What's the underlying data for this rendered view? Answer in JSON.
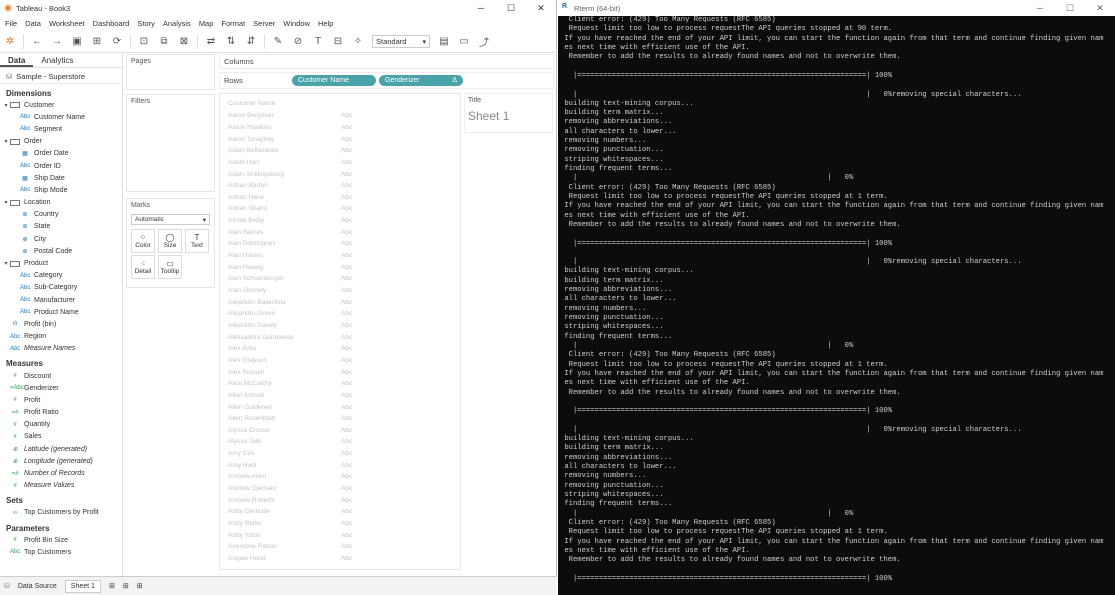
{
  "tableau": {
    "title": "Tableau - Book3",
    "menu": [
      "File",
      "Data",
      "Worksheet",
      "Dashboard",
      "Story",
      "Analysis",
      "Map",
      "Format",
      "Server",
      "Window",
      "Help"
    ],
    "standard_label": "Standard",
    "tabs": {
      "data": "Data",
      "analytics": "Analytics"
    },
    "source": "Sample - Superstore",
    "dimensions_label": "Dimensions",
    "dimensions": [
      {
        "type": "folder",
        "label": "Customer"
      },
      {
        "type": "field",
        "icon": "Abc",
        "label": "Customer Name"
      },
      {
        "type": "field",
        "icon": "Abc",
        "label": "Segment"
      },
      {
        "type": "folder",
        "label": "Order"
      },
      {
        "type": "field",
        "icon": "▦",
        "label": "Order Date"
      },
      {
        "type": "field",
        "icon": "Abc",
        "label": "Order ID"
      },
      {
        "type": "field",
        "icon": "▦",
        "label": "Ship Date"
      },
      {
        "type": "field",
        "icon": "Abc",
        "label": "Ship Mode"
      },
      {
        "type": "folder",
        "label": "Location"
      },
      {
        "type": "field",
        "icon": "⊕",
        "label": "Country"
      },
      {
        "type": "field",
        "icon": "⊕",
        "label": "State"
      },
      {
        "type": "field",
        "icon": "⊕",
        "label": "City"
      },
      {
        "type": "field",
        "icon": "⊕",
        "label": "Postal Code"
      },
      {
        "type": "folder",
        "label": "Product"
      },
      {
        "type": "field",
        "icon": "Abc",
        "label": "Category"
      },
      {
        "type": "field",
        "icon": "Abc",
        "label": "Sub-Category"
      },
      {
        "type": "field",
        "icon": "Abc",
        "label": "Manufacturer"
      },
      {
        "type": "field",
        "icon": "Abc",
        "label": "Product Name"
      },
      {
        "type": "top",
        "icon": "ılı",
        "label": "Profit (bin)"
      },
      {
        "type": "top",
        "icon": "Abc",
        "label": "Region"
      },
      {
        "type": "top",
        "icon": "Abc",
        "label": "Measure Names",
        "italic": true
      }
    ],
    "measures_label": "Measures",
    "measures": [
      {
        "icon": "#",
        "label": "Discount"
      },
      {
        "icon": "=Abc",
        "label": "Genderizer"
      },
      {
        "icon": "#",
        "label": "Profit"
      },
      {
        "icon": "=#",
        "label": "Profit Ratio"
      },
      {
        "icon": "#",
        "label": "Quantity"
      },
      {
        "icon": "#",
        "label": "Sales"
      },
      {
        "icon": "⊕",
        "label": "Latitude (generated)",
        "italic": true
      },
      {
        "icon": "⊕",
        "label": "Longitude (generated)",
        "italic": true
      },
      {
        "icon": "=#",
        "label": "Number of Records",
        "italic": true
      },
      {
        "icon": "#",
        "label": "Measure Values",
        "italic": true
      }
    ],
    "sets_label": "Sets",
    "sets": [
      {
        "icon": "∞",
        "label": "Top Customers by Profit"
      }
    ],
    "parameters_label": "Parameters",
    "parameters": [
      {
        "icon": "#",
        "label": "Profit Bin Size"
      },
      {
        "icon": "Abc",
        "label": "Top Customers"
      }
    ],
    "pages_label": "Pages",
    "filters_label": "Filters",
    "marks_label": "Marks",
    "marks_type": "Automatic",
    "mark_buttons": [
      {
        "glyph": "⁘",
        "label": "Color"
      },
      {
        "glyph": "◯",
        "label": "Size"
      },
      {
        "glyph": "T",
        "label": "Text"
      },
      {
        "glyph": "⁖",
        "label": "Detail"
      },
      {
        "glyph": "▭",
        "label": "Tooltip"
      }
    ],
    "columns_label": "Columns",
    "rows_label": "Rows",
    "row_pills": [
      "Customer Name",
      "Genderizer"
    ],
    "row_pill_delta": "Δ",
    "viz_header": "Customer Name",
    "viz_rows": [
      "Aaron Bergman",
      "Aaron Hawkins",
      "Aaron Smayling",
      "Adam Bellavance",
      "Adam Hart",
      "Adam Shillingsburg",
      "Adrian Barton",
      "Adrian Hane",
      "Adrian Shami",
      "Aimee Bixby",
      "Alan Barnes",
      "Alan Dominguez",
      "Alan Haines",
      "Alan Hwang",
      "Alan Schoenberger",
      "Alan Shonely",
      "Alejandro Ballentine",
      "Alejandro Grove",
      "Alejandro Savely",
      "Aleksandra Gannaway",
      "Alex Avila",
      "Alex Grayson",
      "Alex Russell",
      "Alice McCarthy",
      "Allen Armold",
      "Allen Goldenen",
      "Allen Rosenblatt",
      "Alyssa Crouse",
      "Alyssa Tate",
      "Amy Cox",
      "Amy Hunt",
      "Andrew Allen",
      "Andrew Gjertsen",
      "Andrew Roberts",
      "Andy Gerbode",
      "Andy Reiter",
      "Andy Yotov",
      "Anemone Ratner",
      "Angele Hood"
    ],
    "viz_value": "Abc",
    "title_label": "Title",
    "sheet_title": "Sheet 1",
    "status": {
      "data_source": "Data Source",
      "sheet": "Sheet 1"
    }
  },
  "rterm": {
    "title": "Rterm (64-bit)",
    "lines": [
      "  Client error: (429) Too Many Requests (RFC 6585)",
      "  Request limit too low to process requestThe API queries stopped at 90 term.",
      " If you have reached the end of your API limit, you can start the function again from that term and continue finding given nam",
      " es next time with efficient use of the API.",
      "  Remember to add the results to already found names and not to overwrite them.",
      "",
      "   |===================================================================| 100%",
      "",
      "   |                                                                   |   0%removing special characters...",
      " building text-mining corpus...",
      " building term matrix...",
      " removing abbreviations...",
      " all characters to lower...",
      " removing numbers...",
      " removing punctuation...",
      " striping whitespaces...",
      " finding frequent terms...",
      "   |                                                          |   0%",
      "  Client error: (429) Too Many Requests (RFC 6585)",
      "  Request limit too low to process requestThe API queries stopped at 1 term.",
      " If you have reached the end of your API limit, you can start the function again from that term and continue finding given nam",
      " es next time with efficient use of the API.",
      "  Remember to add the results to already found names and not to overwrite them.",
      "",
      "   |===================================================================| 100%",
      "",
      "   |                                                                   |   0%removing special characters...",
      " building text-mining corpus...",
      " building term matrix...",
      " removing abbreviations...",
      " all characters to lower...",
      " removing numbers...",
      " removing punctuation...",
      " striping whitespaces...",
      " finding frequent terms...",
      "   |                                                          |   0%",
      "  Client error: (429) Too Many Requests (RFC 6585)",
      "  Request limit too low to process requestThe API queries stopped at 1 term.",
      " If you have reached the end of your API limit, you can start the function again from that term and continue finding given nam",
      " es next time with efficient use of the API.",
      "  Remember to add the results to already found names and not to overwrite them.",
      "",
      "   |===================================================================| 100%",
      "",
      "   |                                                                   |   0%removing special characters...",
      " building text-mining corpus...",
      " building term matrix...",
      " removing abbreviations...",
      " all characters to lower...",
      " removing numbers...",
      " removing punctuation...",
      " striping whitespaces...",
      " finding frequent terms...",
      "   |                                                          |   0%",
      "  Client error: (429) Too Many Requests (RFC 6585)",
      "  Request limit too low to process requestThe API queries stopped at 1 term.",
      " If you have reached the end of your API limit, you can start the function again from that term and continue finding given nam",
      " es next time with efficient use of the API.",
      "  Remember to add the results to already found names and not to overwrite them.",
      "",
      "   |===================================================================| 100%"
    ]
  }
}
